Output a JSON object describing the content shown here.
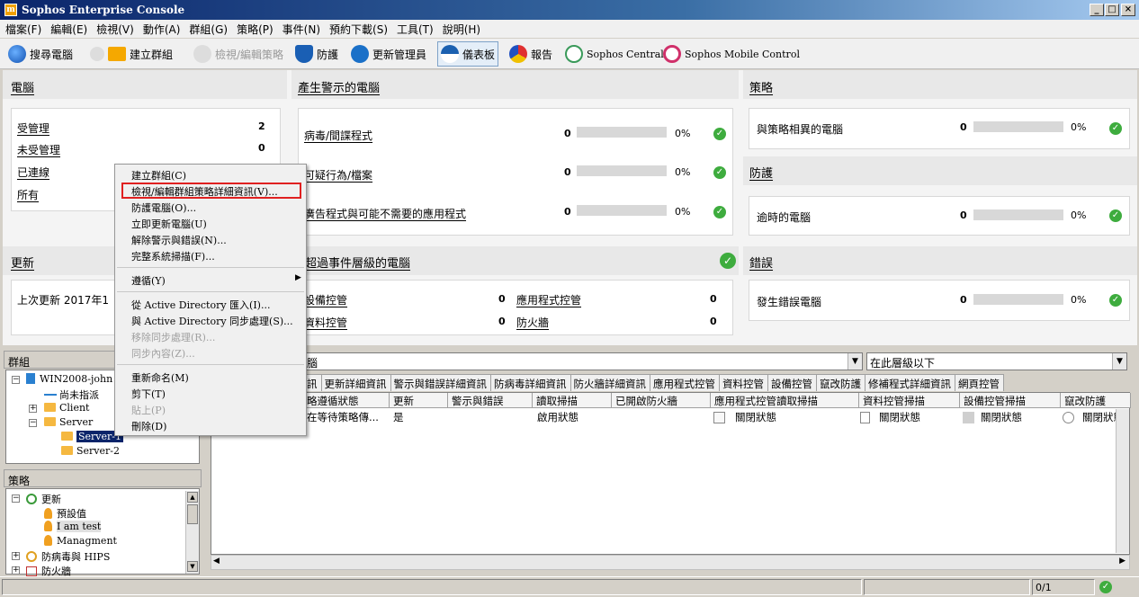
{
  "window": {
    "title": "Sophos Enterprise Console"
  },
  "menu": [
    "檔案(F)",
    "編輯(E)",
    "檢視(V)",
    "動作(A)",
    "群組(G)",
    "策略(P)",
    "事件(N)",
    "預約下載(S)",
    "工具(T)",
    "說明(H)"
  ],
  "toolbar": {
    "search_computers": "搜尋電腦",
    "create_group": "建立群組",
    "view_edit_policy": "檢視/編輯策略",
    "protect": "防護",
    "update_managers": "更新管理員",
    "dashboard": "儀表板",
    "reports": "報告",
    "sophos_central": "Sophos Central",
    "sophos_mobile": "Sophos Mobile Control"
  },
  "computers": {
    "title": "電腦",
    "rows": [
      {
        "label": "受管理",
        "value": "2"
      },
      {
        "label": "未受管理",
        "value": "0"
      },
      {
        "label": "已連線",
        "value": ""
      },
      {
        "label": "所有",
        "value": ""
      }
    ]
  },
  "alerts": {
    "title": "產生警示的電腦",
    "rows": [
      {
        "label": "病毒/間諜程式",
        "value": "0",
        "pct": "0%",
        "fill": 0
      },
      {
        "label": "可疑行為/檔案",
        "value": "0",
        "pct": "0%",
        "fill": 0
      },
      {
        "label": "廣告程式與可能不需要的應用程式",
        "value": "0",
        "pct": "0%",
        "fill": 0
      }
    ]
  },
  "policies": {
    "title": "策略",
    "rows": [
      {
        "label": "與策略相異的電腦",
        "value": "0",
        "pct": "0%",
        "fill": 0
      }
    ]
  },
  "protection": {
    "title": "防護",
    "rows": [
      {
        "label": "逾時的電腦",
        "value": "0",
        "pct": "0%",
        "fill": 0
      }
    ]
  },
  "updates": {
    "title": "更新",
    "last_update": "上次更新  2017年1"
  },
  "events": {
    "title": "超過事件層級的電腦",
    "rows": [
      {
        "label": "設備控管",
        "value": "0",
        "label2": "應用程式控管",
        "value2": "0"
      },
      {
        "label": "資料控管",
        "value": "0",
        "label2": "防火牆",
        "value2": "0"
      }
    ]
  },
  "errors": {
    "title": "錯誤",
    "rows": [
      {
        "label": "發生錯誤電腦",
        "value": "0",
        "pct": "0%",
        "fill": 0
      }
    ]
  },
  "groups_panel": {
    "title": "群組",
    "tree": [
      {
        "label": "WIN2008-john"
      },
      {
        "label": "尚未指派"
      },
      {
        "label": "Client"
      },
      {
        "label": "Server"
      },
      {
        "label": "Server-1"
      },
      {
        "label": "Server-2"
      }
    ]
  },
  "policy_panel": {
    "title": "策略",
    "tree": [
      {
        "label": "更新"
      },
      {
        "label": "預設值"
      },
      {
        "label": "I am test"
      },
      {
        "label": "Managment"
      },
      {
        "label": "防病毒與 HIPS"
      },
      {
        "label": "防火牆"
      }
    ]
  },
  "context_menu": {
    "items": [
      {
        "label": "建立群組(C)",
        "disabled": false
      },
      {
        "label": "檢視/編輯群組策略詳細資訊(V)...",
        "disabled": false
      },
      {
        "label": "防護電腦(O)...",
        "disabled": false
      },
      {
        "label": "立即更新電腦(U)",
        "disabled": false
      },
      {
        "label": "解除警示與錯誤(N)...",
        "disabled": false
      },
      {
        "label": "完整系統掃描(F)...",
        "disabled": false
      },
      {
        "label": "遵循(Y)",
        "disabled": false
      },
      {
        "label": "從 Active Directory 匯入(I)...",
        "disabled": false
      },
      {
        "label": "與 Active Directory 同步處理(S)...",
        "disabled": false
      },
      {
        "label": "移除同步處理(R)...",
        "disabled": true
      },
      {
        "label": "同步內容(Z)...",
        "disabled": true
      },
      {
        "label": "重新命名(M)",
        "disabled": false
      },
      {
        "label": "剪下(T)",
        "disabled": false
      },
      {
        "label": "貼上(P)",
        "disabled": true
      },
      {
        "label": "刪除(D)",
        "disabled": false
      }
    ]
  },
  "filter": {
    "view": "腦",
    "scope": "在此層級以下"
  },
  "tabs": [
    "訊",
    "更新詳細資訊",
    "警示與錯誤詳細資訊",
    "防病毒詳細資訊",
    "防火牆詳細資訊",
    "應用程式控管",
    "資料控管",
    "設備控管",
    "竄改防護",
    "修補程式詳細資訊",
    "網頁控管"
  ],
  "grid": {
    "columns": [
      "略遵循狀態",
      "更新",
      "警示與錯誤",
      "讀取掃描",
      "已開啟防火牆",
      "應用程式控管讀取掃描",
      "資料控管掃描",
      "設備控管掃描",
      "竄改防護"
    ],
    "row": [
      "在等待策略傳...",
      "是",
      "",
      "啟用狀態",
      "",
      "關閉狀態",
      "關閉狀態",
      "關閉狀態",
      "關閉狀態"
    ]
  },
  "status_bar": {
    "page": "0/1"
  }
}
